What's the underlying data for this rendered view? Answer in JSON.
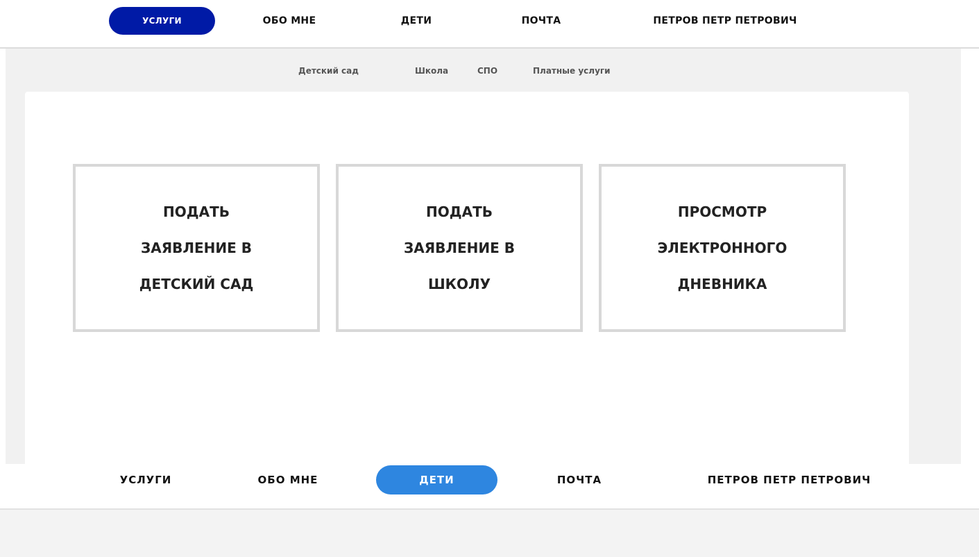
{
  "nav_top": {
    "items": [
      {
        "label": "УСЛУГИ",
        "active": true
      },
      {
        "label": "ОБО МНЕ",
        "active": false
      },
      {
        "label": "ДЕТИ",
        "active": false
      },
      {
        "label": "ПОЧТА",
        "active": false
      },
      {
        "label": "ПЕТРОВ ПЕТР ПЕТРОВИЧ",
        "active": false
      }
    ]
  },
  "subnav": {
    "items": [
      {
        "label": "Детский сад"
      },
      {
        "label": "Школа"
      },
      {
        "label": "СПО"
      },
      {
        "label": "Платные услуги"
      }
    ]
  },
  "cards": [
    {
      "label": "ПОДАТЬ\nЗАЯВЛЕНИЕ В\nДЕТСКИЙ САД"
    },
    {
      "label": "ПОДАТЬ\nЗАЯВЛЕНИЕ В\nШКОЛУ"
    },
    {
      "label": "ПРОСМОТР\nЭЛЕКТРОННОГО\nДНЕВНИКА"
    }
  ],
  "nav_bottom": {
    "items": [
      {
        "label": "УСЛУГИ",
        "active": false
      },
      {
        "label": "ОБО МНЕ",
        "active": false
      },
      {
        "label": "ДЕТИ",
        "active": true
      },
      {
        "label": "ПОЧТА",
        "active": false
      },
      {
        "label": "ПЕТРОВ ПЕТР ПЕТРОВИЧ",
        "active": false
      }
    ]
  },
  "colors": {
    "nav_top_active": "#001aa6",
    "nav_bottom_active": "#2e86e0",
    "page_gray": "#f1f1f1",
    "card_border": "#d8d8d8"
  }
}
